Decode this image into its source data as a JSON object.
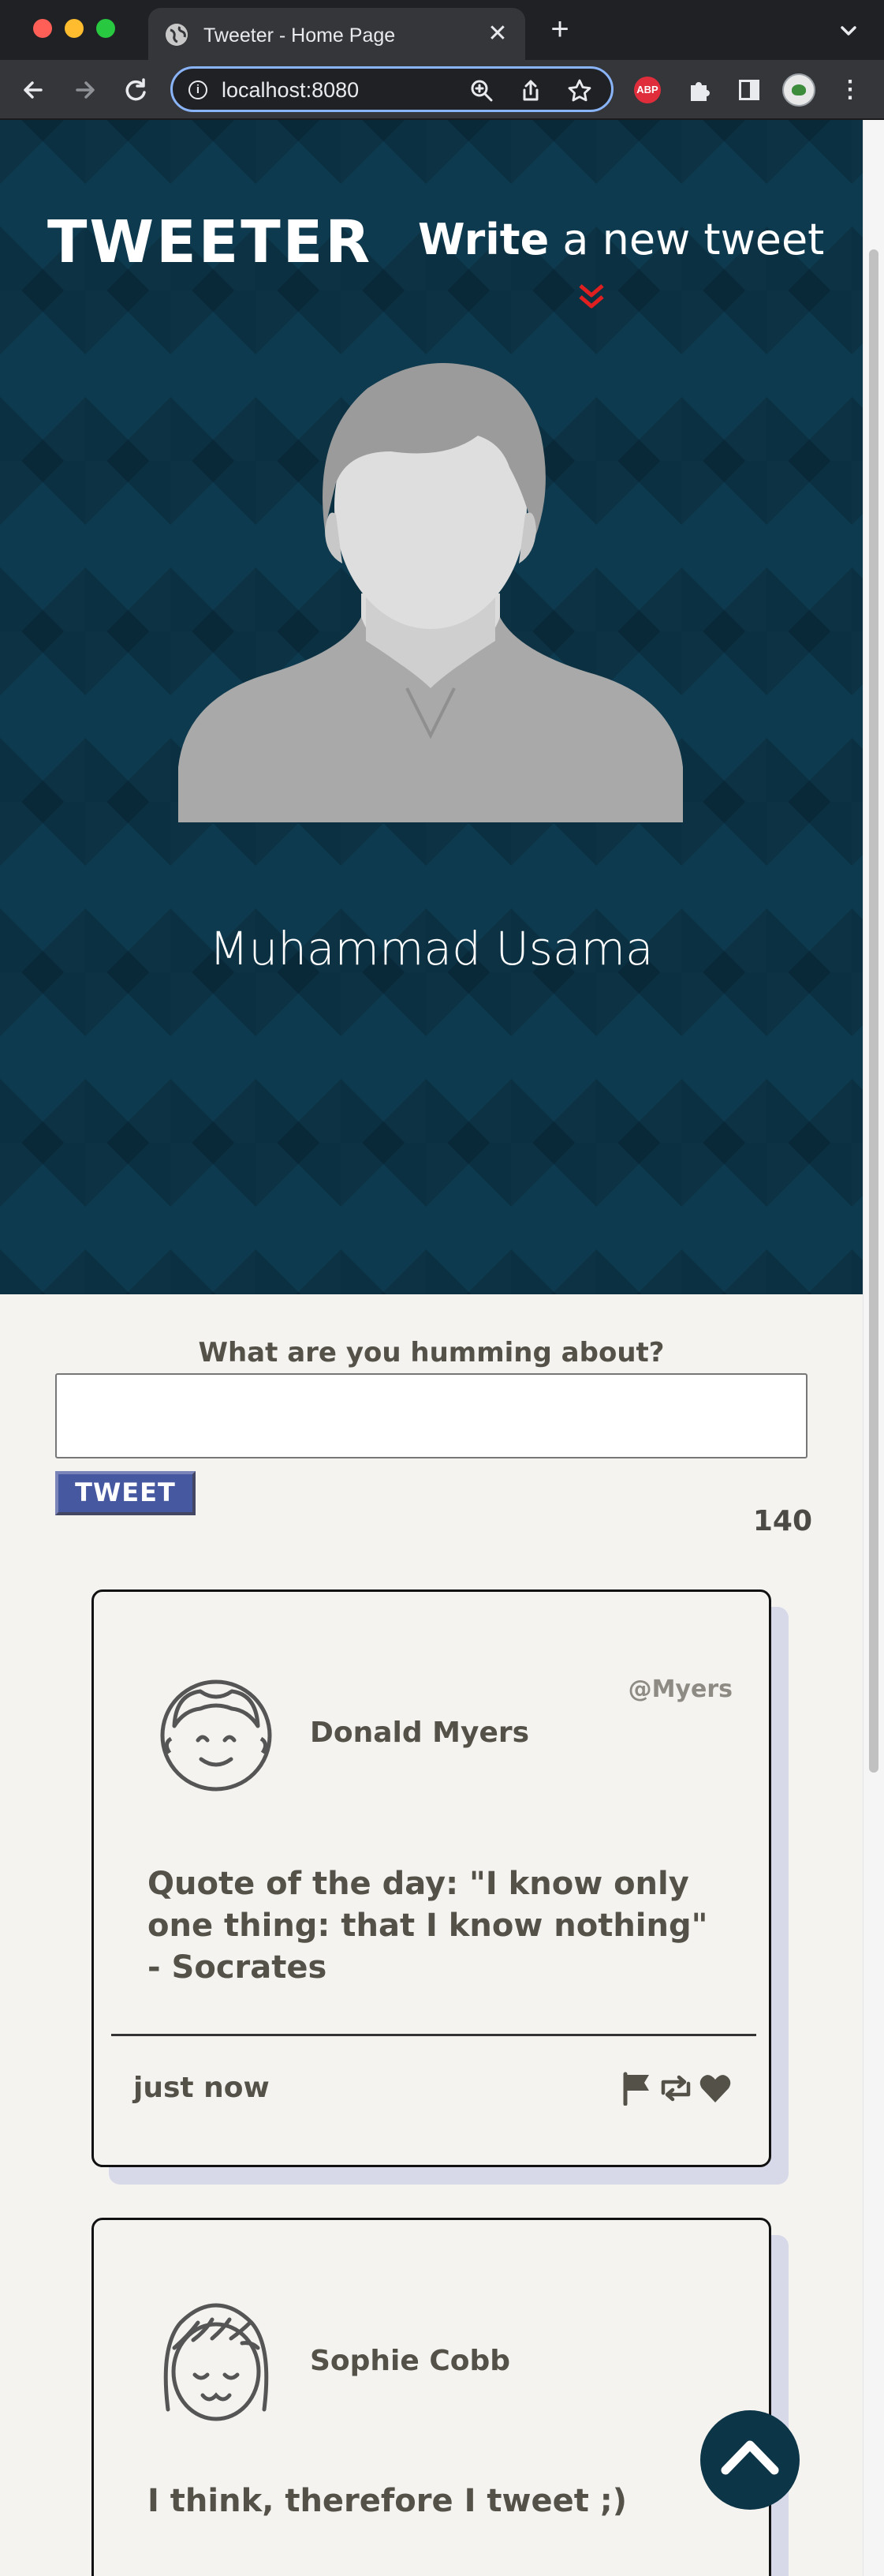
{
  "browser": {
    "tab_title": "Tweeter - Home Page",
    "tab_close": "✕",
    "new_tab": "+",
    "url": "localhost:8080",
    "abp_badge": "ABP",
    "kebab": "⋮"
  },
  "header": {
    "logo": "TWEETER",
    "compose_bold": "Write",
    "compose_rest": " a new tweet"
  },
  "profile": {
    "name": "Muhammad Usama"
  },
  "compose": {
    "label": "What are you humming about?",
    "value": "",
    "button": "TWEET",
    "counter": "140"
  },
  "tweets": [
    {
      "name": "Donald Myers",
      "handle": "@Myers",
      "text": "Quote of the day: \"I know only one thing: that I know nothing\" - Socrates",
      "time": "just now"
    },
    {
      "name": "Sophie Cobb",
      "handle": "",
      "text": "I think, therefore I tweet ;)",
      "time": ""
    }
  ],
  "icons": {
    "compose_chevron": "double-chevron-down-icon",
    "flag": "flag-icon",
    "retweet": "retweet-icon",
    "like": "heart-icon",
    "scroll_top": "chevron-up-icon"
  },
  "colors": {
    "hero_bg": "#0e3a4f",
    "accent_red": "#e02020",
    "button_blue": "#4658a0",
    "card_shadow": "#d7d9e9",
    "page_bg": "#f4f3ef"
  }
}
